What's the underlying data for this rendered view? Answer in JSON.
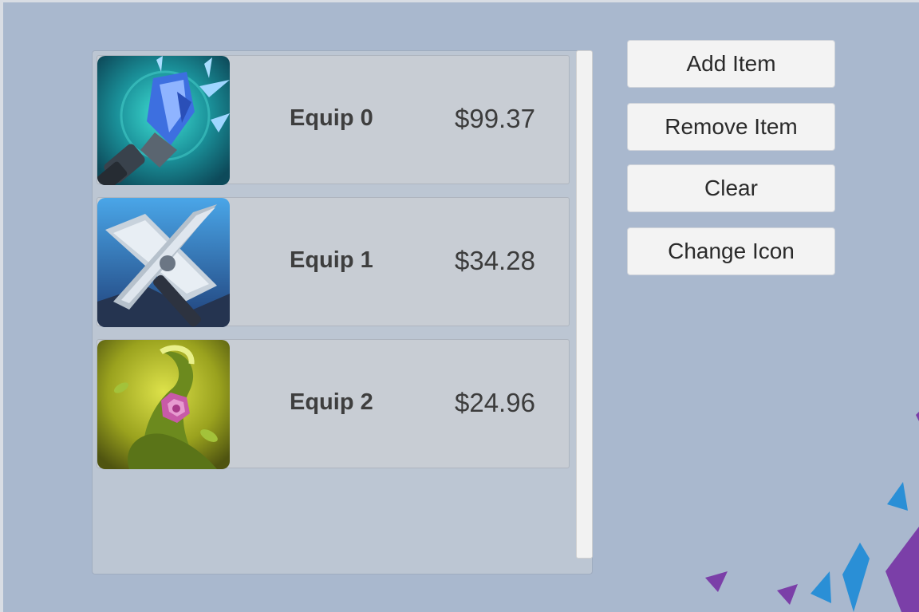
{
  "inventory": {
    "items": [
      {
        "name": "Equip 0",
        "price": "$99.37",
        "icon": "crystal-staff-icon"
      },
      {
        "name": "Equip 1",
        "price": "$34.28",
        "icon": "cross-spear-icon"
      },
      {
        "name": "Equip 2",
        "price": "$24.96",
        "icon": "vine-gem-icon"
      }
    ]
  },
  "buttons": {
    "add": "Add Item",
    "remove": "Remove Item",
    "clear": "Clear",
    "change_icon": "Change Icon"
  },
  "colors": {
    "background": "#a9b8ce",
    "row": "#c8cdd4",
    "button": "#f3f3f3",
    "accent_blue": "#2a8fd6",
    "accent_purple": "#7b3fa8"
  }
}
